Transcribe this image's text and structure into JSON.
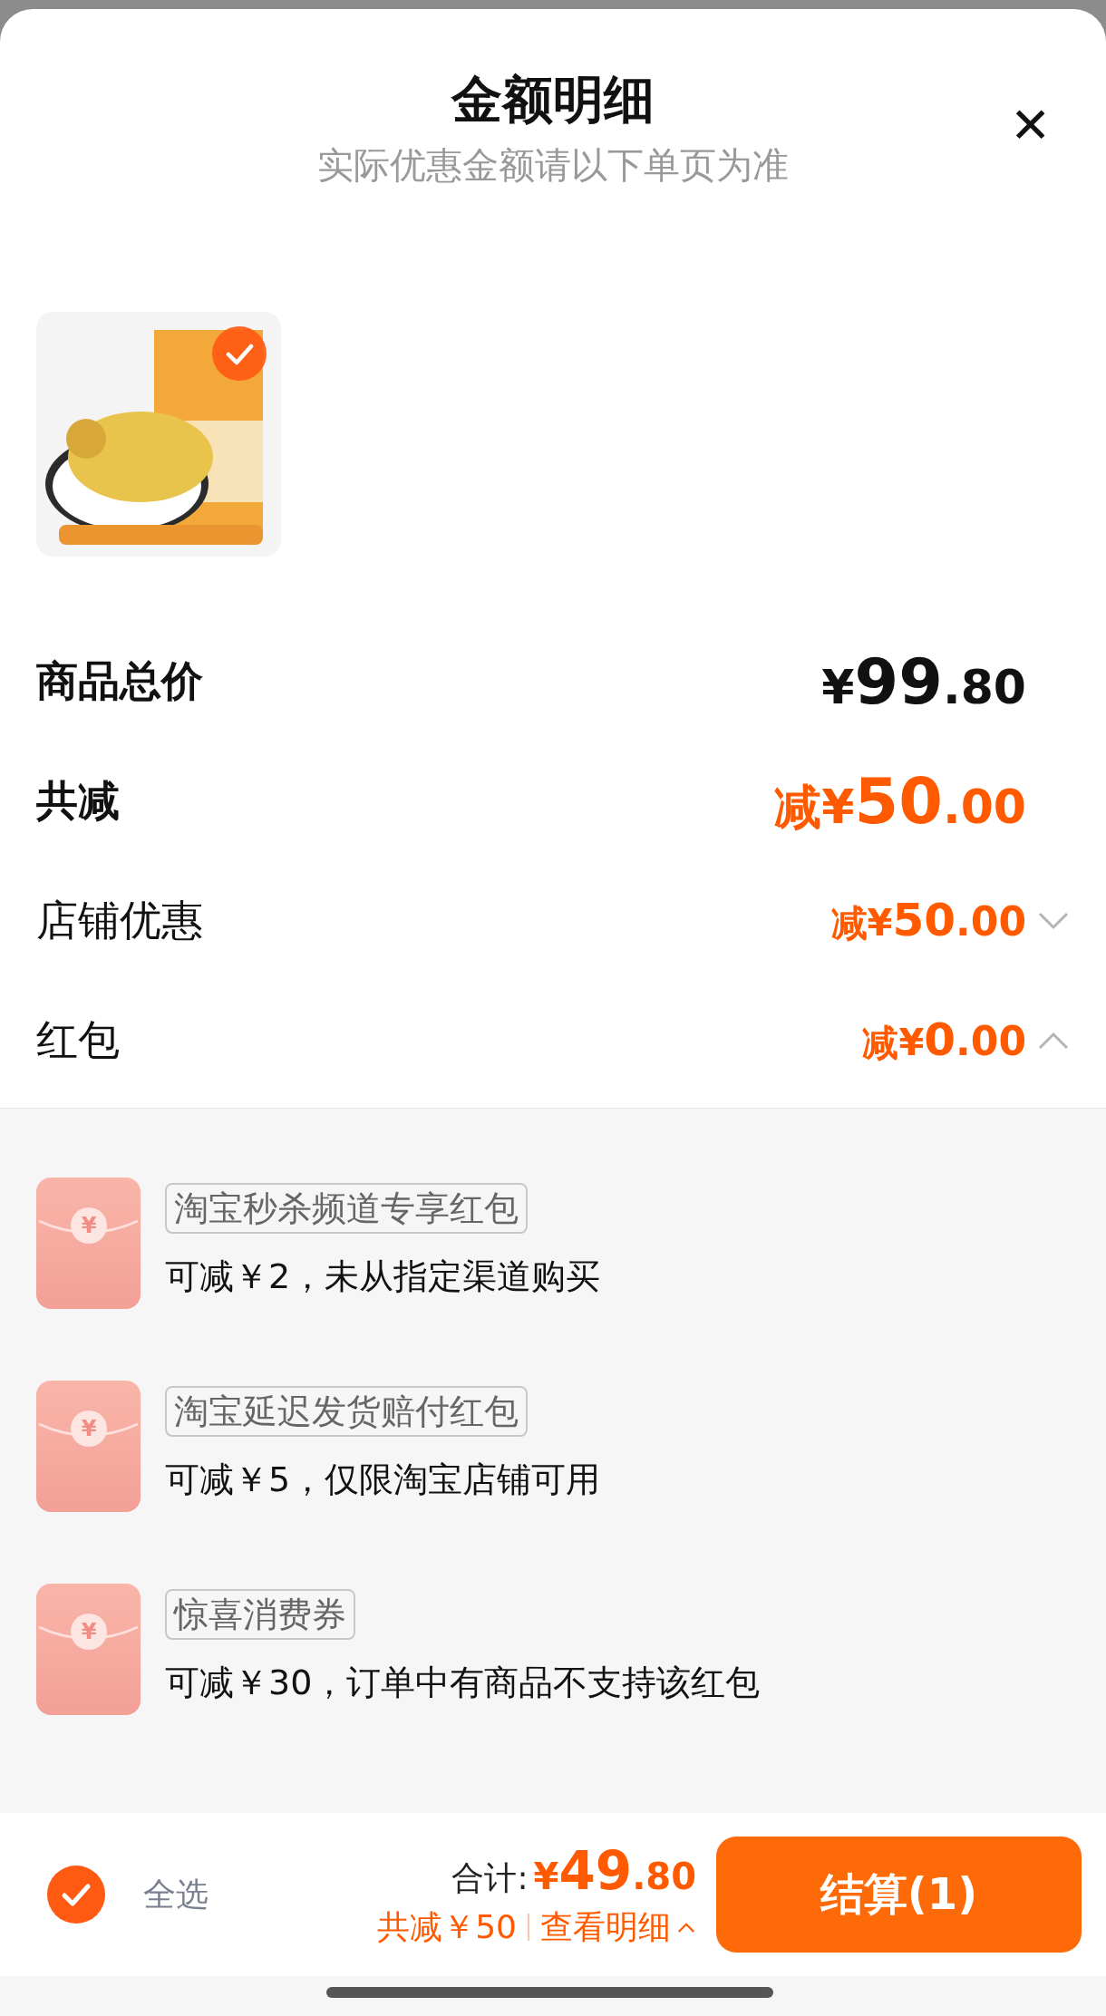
{
  "sheet": {
    "title": "金额明细",
    "subtitle": "实际优惠金额请以下单页为准",
    "close_icon": "✕"
  },
  "products": [
    {
      "kind": "picture",
      "selected": true
    }
  ],
  "summary": [
    {
      "kind": "total",
      "label": "商品总价",
      "currency": "¥",
      "integer": "99",
      "decimal": ".80"
    },
    {
      "kind": "discount",
      "label": "共减",
      "prefix": "减",
      "currency": "¥",
      "integer": "50",
      "decimal": ".00"
    },
    {
      "kind": "sub",
      "label": "店铺优惠",
      "prefix": "减",
      "currency": "¥",
      "integer": "50",
      "decimal": ".00",
      "expanded": false
    },
    {
      "kind": "sub",
      "label": "红包",
      "prefix": "减",
      "currency": "¥",
      "integer": "0",
      "decimal": ".00",
      "expanded": true
    }
  ],
  "red_packets": [
    {
      "symbol": "¥",
      "name": "淘宝秒杀频道专享红包",
      "note": "可减￥2，未从指定渠道购买"
    },
    {
      "symbol": "¥",
      "name": "淘宝延迟发货赔付红包",
      "note": "可减￥5，仅限淘宝店铺可用"
    },
    {
      "symbol": "¥",
      "name": "惊喜消费券",
      "note": "可减￥30，订单中有商品不支持该红包"
    }
  ],
  "footer": {
    "select_all": {
      "label": "全选",
      "checked": true
    },
    "total_label": "合计:",
    "total_currency": "¥",
    "total_integer": "49",
    "total_decimal": ".80",
    "saved": "共减￥50",
    "details_link": "查看明细",
    "checkout": "结算(1)"
  }
}
